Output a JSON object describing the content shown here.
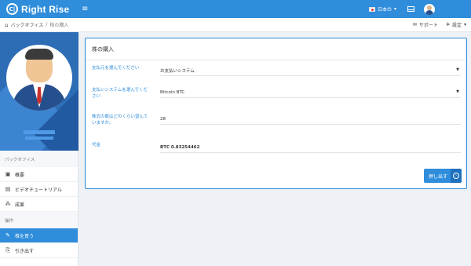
{
  "brand": {
    "name": "Right Rise",
    "logo_glyph": "C|"
  },
  "topbar": {
    "menu_icon": "hamburger-icon",
    "language_label": "日本の",
    "language_caret": "▾",
    "mail_icon": "mail-icon",
    "avatar_icon": "user-avatar-icon"
  },
  "breadcrumb": {
    "home_icon": "home-icon",
    "items": [
      "バックオフィス",
      "株の購入"
    ],
    "separator": "/",
    "support_label": "サポート",
    "support_icon": "chat-icon",
    "settings_label": "設定",
    "settings_icon": "gear-icon",
    "settings_caret": "▾"
  },
  "sidebar": {
    "section1": "バックオフィス",
    "items1": [
      {
        "label": "概要",
        "icon": "briefcase-icon",
        "glyph": "▣"
      },
      {
        "label": "ビデオチュートリアル",
        "icon": "video-icon",
        "glyph": "▤"
      },
      {
        "label": "成果",
        "icon": "network-icon",
        "glyph": "⁂"
      }
    ],
    "section2": "操作",
    "items2": [
      {
        "label": "株を買う",
        "icon": "edit-icon",
        "glyph": "✎",
        "active": true
      },
      {
        "label": "引き出す",
        "icon": "withdraw-icon",
        "glyph": "⎘",
        "active": false
      }
    ]
  },
  "card": {
    "title": "株の購入",
    "rows": [
      {
        "label": "支払元を選んでください",
        "value": "お支払いシステム",
        "has_caret": true
      },
      {
        "label": "支払いシステムを選んでください",
        "value": "Bitcoin BTC",
        "has_caret": true
      },
      {
        "label": "株式の数はどのくらい望んていますか。",
        "value": "28",
        "has_caret": false
      },
      {
        "label": "代金",
        "value": "BTC 0.83254462",
        "has_caret": false
      }
    ],
    "submit_label": "押し出す",
    "submit_icon": "arrow-right-circle-icon"
  },
  "colors": {
    "accent": "#2f8ddb",
    "topbar": "#2f8ddb",
    "background": "#eef1f5"
  }
}
